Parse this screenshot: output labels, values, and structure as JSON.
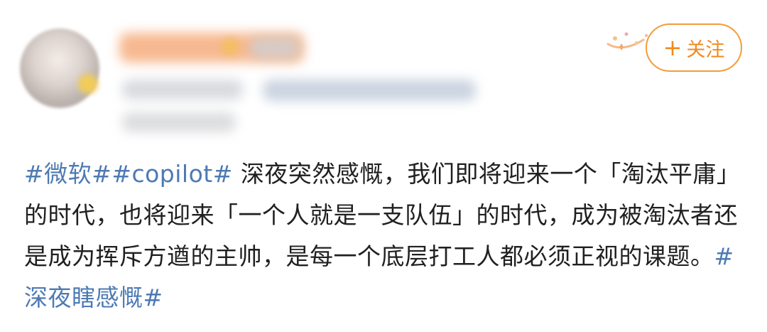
{
  "header": {
    "follow_label": "关注",
    "follow_plus": "+"
  },
  "post": {
    "topic_1": "#微软#",
    "topic_2": "#copilot#",
    "body": " 深夜突然感慨，我们即将迎来一个「淘汰平庸」的时代，也将迎来「一个人就是一支队伍」的时代，成为被淘汰者还是成为挥斥方遒的主帅，是每一个底层打工人都必须正视的课题。",
    "topic_3": "#深夜瞎感慨#"
  },
  "colors": {
    "topic": "#4d7ab3",
    "follow_accent": "#f39c3b",
    "text": "#202020"
  },
  "icons": {
    "follow": "plus-icon",
    "decoration": "sparkle-icon"
  }
}
